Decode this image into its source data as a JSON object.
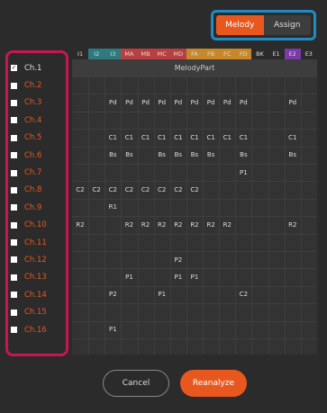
{
  "toggle": {
    "melody_label": "Melody",
    "assign_label": "Assign",
    "active": "Melody"
  },
  "channels": [
    {
      "label": "Ch.1",
      "checked": true
    },
    {
      "label": "Ch.2",
      "checked": false
    },
    {
      "label": "Ch.3",
      "checked": false
    },
    {
      "label": "Ch.4",
      "checked": false
    },
    {
      "label": "Ch.5",
      "checked": false
    },
    {
      "label": "Ch.6",
      "checked": false
    },
    {
      "label": "Ch.7",
      "checked": false
    },
    {
      "label": "Ch.8",
      "checked": false
    },
    {
      "label": "Ch.9",
      "checked": false
    },
    {
      "label": "Ch.10",
      "checked": false
    },
    {
      "label": "Ch.11",
      "checked": false
    },
    {
      "label": "Ch.12",
      "checked": false
    },
    {
      "label": "Ch.13",
      "checked": false
    },
    {
      "label": "Ch.14",
      "checked": false
    },
    {
      "label": "Ch.15",
      "checked": false
    },
    {
      "label": "Ch.16",
      "checked": false
    }
  ],
  "columns": [
    {
      "label": "I1",
      "color": "#2b2b2b"
    },
    {
      "label": "I2",
      "color": "#2f7a7e"
    },
    {
      "label": "I3",
      "color": "#2f7a7e"
    },
    {
      "label": "MA",
      "color": "#b84040"
    },
    {
      "label": "MB",
      "color": "#b84040"
    },
    {
      "label": "MC",
      "color": "#b84040"
    },
    {
      "label": "MD",
      "color": "#b84040"
    },
    {
      "label": "FA",
      "color": "#c7882c"
    },
    {
      "label": "FB",
      "color": "#c7882c"
    },
    {
      "label": "FC",
      "color": "#c7882c"
    },
    {
      "label": "FD",
      "color": "#c7882c"
    },
    {
      "label": "BK",
      "color": "#2b2b2b"
    },
    {
      "label": "E1",
      "color": "#2b2b2b"
    },
    {
      "label": "E2",
      "color": "#7a3aa8"
    },
    {
      "label": "E3",
      "color": "#2b2b2b"
    }
  ],
  "melody_part_label": "MelodyPart",
  "grid_rows": [
    [
      "",
      "",
      "",
      "",
      "",
      "",
      "",
      "",
      "",
      "",
      "",
      "",
      "",
      "",
      ""
    ],
    [
      "",
      "",
      "Pd",
      "Pd",
      "Pd",
      "Pd",
      "Pd",
      "Pd",
      "Pd",
      "Pd",
      "Pd",
      "",
      "",
      "Pd",
      ""
    ],
    [
      "",
      "",
      "",
      "",
      "",
      "",
      "",
      "",
      "",
      "",
      "",
      "",
      "",
      "",
      ""
    ],
    [
      "",
      "",
      "C1",
      "C1",
      "C1",
      "C1",
      "C1",
      "C1",
      "C1",
      "C1",
      "C1",
      "",
      "",
      "C1",
      ""
    ],
    [
      "",
      "",
      "Bs",
      "Bs",
      "",
      "Bs",
      "Bs",
      "Bs",
      "Bs",
      "",
      "Bs",
      "",
      "",
      "Bs",
      ""
    ],
    [
      "",
      "",
      "",
      "",
      "",
      "",
      "",
      "",
      "",
      "",
      "P1",
      "",
      "",
      "",
      ""
    ],
    [
      "C2",
      "C2",
      "C2",
      "C2",
      "C2",
      "C2",
      "C2",
      "C2",
      "",
      "",
      "",
      "",
      "",
      "",
      ""
    ],
    [
      "",
      "",
      "R1",
      "",
      "",
      "",
      "",
      "",
      "",
      "",
      "",
      "",
      "",
      "",
      ""
    ],
    [
      "R2",
      "",
      "",
      "R2",
      "R2",
      "R2",
      "R2",
      "R2",
      "R2",
      "R2",
      "",
      "",
      "",
      "R2",
      ""
    ],
    [
      "",
      "",
      "",
      "",
      "",
      "",
      "",
      "",
      "",
      "",
      "",
      "",
      "",
      "",
      ""
    ],
    [
      "",
      "",
      "",
      "",
      "",
      "",
      "P2",
      "",
      "",
      "",
      "",
      "",
      "",
      "",
      ""
    ],
    [
      "",
      "",
      "",
      "P1",
      "",
      "",
      "P1",
      "P1",
      "",
      "",
      "",
      "",
      "",
      "",
      ""
    ],
    [
      "",
      "",
      "P2",
      "",
      "",
      "P1",
      "",
      "",
      "",
      "",
      "C2",
      "",
      "",
      "",
      ""
    ],
    [
      "",
      "",
      "",
      "",
      "",
      "",
      "",
      "",
      "",
      "",
      "",
      "",
      "",
      "",
      ""
    ],
    [
      "",
      "",
      "P1",
      "",
      "",
      "",
      "",
      "",
      "",
      "",
      "",
      "",
      "",
      "",
      ""
    ]
  ],
  "buttons": {
    "cancel": "Cancel",
    "reanalyze": "Reanalyze"
  }
}
